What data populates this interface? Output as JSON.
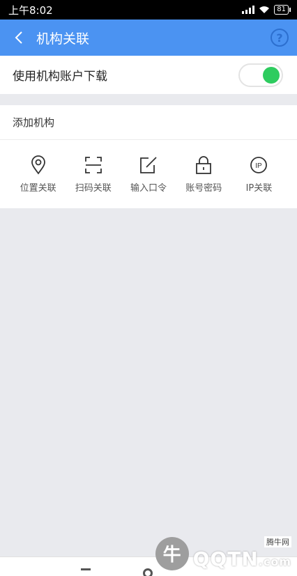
{
  "status": {
    "time": "上午8:02",
    "battery": "81"
  },
  "header": {
    "title": "机构关联",
    "back_icon": "chevron-left-icon",
    "help_icon": "help-circle-icon",
    "help_glyph": "?"
  },
  "toggle": {
    "label": "使用机构账户下载",
    "enabled": true,
    "knob_color": "#2ecc5f"
  },
  "add_section": {
    "title": "添加机构",
    "methods": [
      {
        "label": "位置关联",
        "icon": "location-pin-icon"
      },
      {
        "label": "扫码关联",
        "icon": "scan-icon"
      },
      {
        "label": "输入口令",
        "icon": "edit-icon"
      },
      {
        "label": "账号密码",
        "icon": "lock-icon"
      },
      {
        "label": "IP关联",
        "icon": "ip-icon"
      }
    ]
  },
  "watermark": {
    "small": "腾牛网",
    "big": "QQTN",
    "suffix": ".com",
    "glyph": "牛"
  },
  "colors": {
    "accent": "#4b93f2",
    "background": "#e9eaee"
  }
}
